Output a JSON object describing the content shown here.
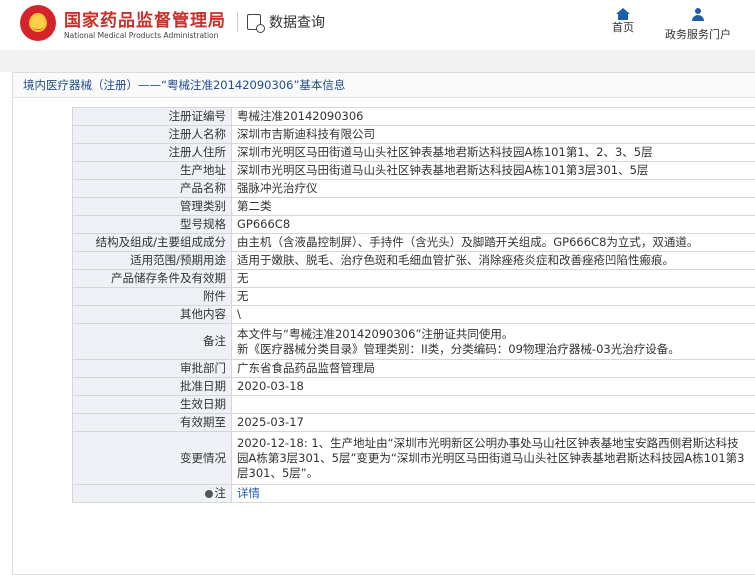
{
  "header": {
    "org_cn": "国家药品监督管理局",
    "org_en": "National Medical Products Administration",
    "query_label": "数据查询",
    "nav_home": "首页",
    "nav_gov": "政务服务门户"
  },
  "breadcrumb": "境内医疗器械（注册）——“粤械注准20142090306”基本信息",
  "rows": [
    {
      "k": "注册证编号",
      "v": "粤械注准20142090306"
    },
    {
      "k": "注册人名称",
      "v": "深圳市吉斯迪科技有限公司"
    },
    {
      "k": "注册人住所",
      "v": "深圳市光明区马田街道马山头社区钟表基地君斯达科技园A栋101第1、2、3、5层"
    },
    {
      "k": "生产地址",
      "v": "深圳市光明区马田街道马山头社区钟表基地君斯达科技园A栋101第3层301、5层"
    },
    {
      "k": "产品名称",
      "v": "强脉冲光治疗仪"
    },
    {
      "k": "管理类别",
      "v": "第二类"
    },
    {
      "k": "型号规格",
      "v": "GP666C8"
    },
    {
      "k": "结构及组成/主要组成成分",
      "v": "由主机（含液晶控制屏）、手持件（含光头）及脚踏开关组成。GP666C8为立式，双通道。"
    },
    {
      "k": "适用范围/预期用途",
      "v": "适用于嫩肤、脱毛、治疗色斑和毛细血管扩张、消除痤疮炎症和改善痤疮凹陷性瘢痕。"
    },
    {
      "k": "产品储存条件及有效期",
      "v": "无"
    },
    {
      "k": "附件",
      "v": "无"
    },
    {
      "k": "其他内容",
      "v": "\\"
    },
    {
      "k": "备注",
      "v1": "本文件与“粤械注准20142090306”注册证共同使用。",
      "v2": "新《医疗器械分类目录》管理类别：II类，分类编码：09物理治疗器械-03光治疗设备。"
    },
    {
      "k": "审批部门",
      "v": "广东省食品药品监督管理局"
    },
    {
      "k": "批准日期",
      "v": "2020-03-18"
    },
    {
      "k": "生效日期",
      "v": ""
    },
    {
      "k": "有效期至",
      "v": "2025-03-17"
    },
    {
      "k": "变更情况",
      "v": "2020-12-18: 1、生产地址由“深圳市光明新区公明办事处马山社区钟表基地宝安路西侧君斯达科技园A栋第3层301、5层”变更为“深圳市光明区马田街道马山头社区钟表基地君斯达科技园A栋101第3层301、5层”。"
    },
    {
      "k": "注",
      "v": "详情"
    }
  ]
}
